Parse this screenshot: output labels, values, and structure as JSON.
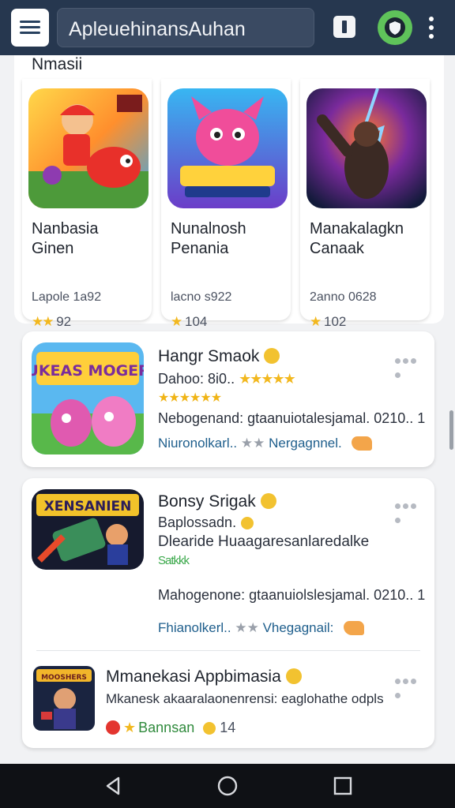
{
  "header": {
    "search_text": "ApleuehinansAuhan",
    "icons": [
      "menu-icon",
      "tab-icon",
      "shield-icon",
      "more-vert-icon"
    ],
    "accent": "#5fc35a",
    "bar_color": "#26374f"
  },
  "section": {
    "title": "Nmasii"
  },
  "featured": [
    {
      "name_line1": "Nanbasia",
      "name_line2": "Ginen",
      "meta": "Lapole 1a92",
      "rating": "92"
    },
    {
      "name_line1": "Nunalnosh",
      "name_line2": "Penania",
      "meta": "lacno s922",
      "rating": "104"
    },
    {
      "name_line1": "Manakalagkn",
      "name_line2": "Canaak",
      "meta": "2anno 0628",
      "rating": "102"
    }
  ],
  "list": [
    {
      "title": "Hangr Smaok",
      "line1": "Dahoo: 8i0..",
      "desc": "Nebogenand: gtaanuiotalesjamal. 0210.. 1",
      "link_left": "Niuronolkarl..",
      "link_right": "Nergagnnel.",
      "art": "SNUKEAS MOGERAS"
    },
    {
      "title": "Bonsy Srigak",
      "line1": "Baplossadn.",
      "line2": "Dlearide Huaagaresanlaredalke",
      "stars_text": "Satkkk",
      "desc": "Mahogenone: gtaanuiolslesjamal. 0210.. 1",
      "link_left": "Fhianolkerl..",
      "link_right": "Vhegagnail:",
      "art": "XENSANIEN"
    },
    {
      "title": "Mmanekasi Appbimasia",
      "desc": "Mkanesk akaaralaonenrensi: eaglohathe odpls",
      "badge_text": "Bannsan",
      "count": "14",
      "art": "MOOSHERS"
    }
  ],
  "navbar": {
    "icons": [
      "back-icon",
      "home-icon",
      "recents-icon"
    ]
  }
}
